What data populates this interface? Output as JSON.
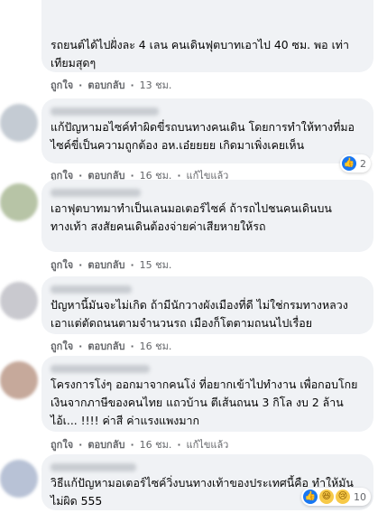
{
  "comments": [
    {
      "text": "รถยนต์ได้ไปฝั่งละ 4 เลน คนเดินฟุตบาทเอาไป 40 ซม. พอ เท่าเทียมสุดๆ",
      "like": "ถูกใจ",
      "reply": "ตอบกลับ",
      "time": "13 ชม.",
      "avatar_color": "#d9c2c2"
    },
    {
      "text": "แก้ปัญหามอไซค์ทำผิดขี่รถบนทางคนเดิน โดยการทำให้ทางที่มอไซค์ขี่เป็นความถูกต้อง อห.เอ๋ยยยย เกิดมาเพิ่งเคยเห็น",
      "like": "ถูกใจ",
      "reply": "ตอบกลับ",
      "time": "16 ชม.",
      "edited": "แก้ไขแล้ว",
      "reaction_count": "2",
      "avatar_color": "#c4cbd3"
    },
    {
      "text": "เอาฟุตบาทมาทำเป็นเลนมอเตอร์ไซค์ ถ้ารถไปชนคนเดินบนทางเท้า สงสัยคนเดินต้องจ่ายค่าเสียหายให้รถ",
      "like": "ถูกใจ",
      "reply": "ตอบกลับ",
      "time": "15 ชม.",
      "avatar_color": "#b7c4a6"
    },
    {
      "text": "ปัญหานี้มันจะไม่เกิด ถ้ามีนักวางผังเมืองที่ดี ไม่ใช่กรมทางหลวงเอาแต่ตัดถนนตามจำนวนรถ เมืองก็โตตามถนนไปเรื่อย",
      "like": "ถูกใจ",
      "reply": "ตอบกลับ",
      "time": "16 ชม.",
      "reaction_count": "",
      "avatar_color": "#c9c9cf"
    },
    {
      "text": "โครงการโง่ๆ ออกมาจากคนโง่ ที่อยากเข้าไปทำงาน เพื่อกอบโกยเงินจากภาษีของคนไทย แถวบ้าน ตีเส้นถนน 3 กิโล งบ 2 ล้าน ไอ้เ... !!!! ค่าสี ค่าแรงแพงมาก",
      "like": "ถูกใจ",
      "reply": "ตอบกลับ",
      "time": "16 ชม.",
      "edited": "แก้ไขแล้ว",
      "avatar_color": "#c6a99b"
    },
    {
      "text": "วิธีแก้ปัญหามอเตอร์ไซค์วิ่งบนทางเท้าของประเทศนี้คือ ทำให้มันไม่ผิด 555",
      "reaction_count": "10",
      "avatar_color": "#b8c2d6"
    }
  ],
  "separator": "·",
  "reactions": {
    "like": "like-icon",
    "haha": "haha-icon",
    "sad": "sad-icon"
  }
}
